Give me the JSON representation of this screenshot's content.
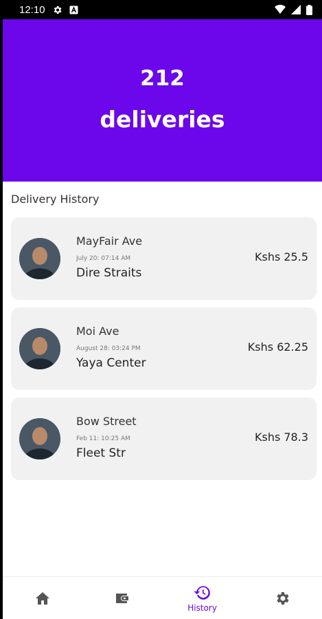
{
  "status_bar": {
    "time": "12:10"
  },
  "header": {
    "count": "212",
    "unit": "deliveries",
    "color": "#6b07ea"
  },
  "section_title": "Delivery History",
  "deliveries": [
    {
      "street": "MayFair Ave",
      "timestamp": "July 20: 07:14 AM",
      "place": "Dire Straits",
      "price": "Kshs 25.5"
    },
    {
      "street": "Moi Ave",
      "timestamp": "August 28: 03:24 PM",
      "place": "Yaya Center",
      "price": "Kshs 62.25"
    },
    {
      "street": "Bow Street",
      "timestamp": "Feb 11: 10:25 AM",
      "place": "Fleet Str",
      "price": "Kshs 78.3"
    }
  ],
  "bottom_nav": {
    "items": [
      {
        "icon": "home-icon",
        "label": ""
      },
      {
        "icon": "wallet-icon",
        "label": ""
      },
      {
        "icon": "history-icon",
        "label": "History",
        "active": true
      },
      {
        "icon": "gear-icon",
        "label": ""
      }
    ]
  }
}
